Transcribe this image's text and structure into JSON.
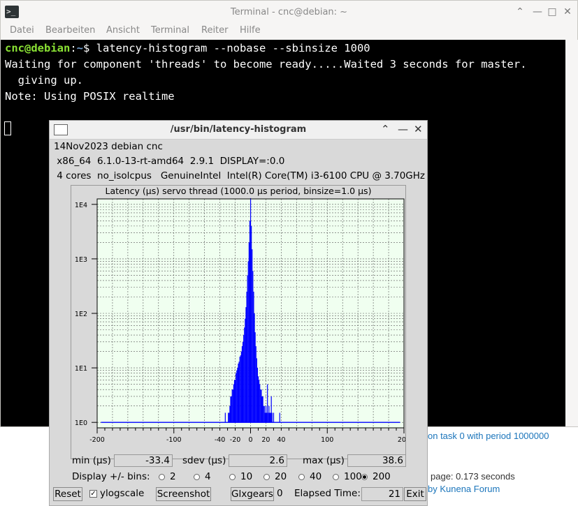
{
  "background": {
    "line1": "on task 0 with period 1000000",
    "line2": "page: 0.173 seconds",
    "line3": "by Kunena Forum"
  },
  "terminal": {
    "title": "Terminal - cnc@debian: ~",
    "menu": [
      "Datei",
      "Bearbeiten",
      "Ansicht",
      "Terminal",
      "Reiter",
      "Hilfe"
    ],
    "prompt_user": "cnc@debian",
    "prompt_sep": ":",
    "prompt_path": "~",
    "prompt_end": "$ latency-histogram --nobase --sbinsize 1000",
    "output": [
      "Waiting for component 'threads' to become ready.....Waited 3 seconds for master.",
      "  giving up.",
      "Note: Using POSIX realtime"
    ]
  },
  "histogram_window": {
    "title": "/usr/bin/latency-histogram",
    "info_line1": "14Nov2023 debian cnc",
    "info_line2": " x86_64  6.1.0-13-rt-amd64  2.9.1  DISPLAY=:0.0",
    "info_line3": " 4 cores  no_isolcpus   GenuineIntel  Intel(R) Core(TM) i3-6100 CPU @ 3.70GHz",
    "stats": {
      "min_label": "min (µs)",
      "min_value": "-33.4",
      "sdev_label": "sdev (µs)",
      "sdev_value": "2.6",
      "max_label": "max (µs)",
      "max_value": "38.6"
    },
    "bins_label": "Display +/- bins:",
    "bins_options": [
      "2",
      "4",
      "10",
      "20",
      "40",
      "100",
      "200"
    ],
    "bins_selected": "200",
    "buttons": {
      "reset": "Reset",
      "ylogscale": "ylogscale",
      "screenshot": "Screenshot",
      "glxgears": "Glxgears",
      "glxgears_count": "0",
      "elapsed_label": "Elapsed Time:",
      "elapsed_value": "21",
      "exit": "Exit"
    },
    "colors": {
      "bars": "#0000ff",
      "plot_bg": "#f0fff0",
      "grid": "#555555"
    }
  },
  "chart_data": {
    "type": "bar",
    "title": "Latency (µs) servo thread (1000.0 µs period, binsize=1.0 µs)",
    "xlabel": "",
    "ylabel": "",
    "xlim": [
      -200,
      200
    ],
    "ylim_log10": [
      -0.1,
      4.1
    ],
    "log_scale_y": true,
    "x_ticks": [
      -200,
      -100,
      -40,
      -20,
      0,
      20,
      40,
      100,
      200
    ],
    "x_tick_labels": [
      "-200",
      "-100",
      "-40",
      "-20",
      "0",
      "20",
      "40",
      "100",
      "200"
    ],
    "y_tick_labels": [
      "1E0",
      "1E1",
      "1E2",
      "1E3",
      "1E4"
    ],
    "grid": true,
    "series": [
      {
        "values": [
          [
            -33,
            1.5
          ],
          [
            -29,
            1.5
          ],
          [
            -28,
            1.5
          ],
          [
            -27,
            2
          ],
          [
            -26,
            3
          ],
          [
            -25,
            3
          ],
          [
            -24,
            4
          ],
          [
            -23,
            4
          ],
          [
            -22,
            5
          ],
          [
            -21,
            6
          ],
          [
            -20,
            6
          ],
          [
            -19,
            8
          ],
          [
            -18,
            9
          ],
          [
            -17,
            10
          ],
          [
            -16,
            12
          ],
          [
            -15,
            13
          ],
          [
            -14,
            16
          ],
          [
            -13,
            17
          ],
          [
            -12,
            20
          ],
          [
            -11,
            25
          ],
          [
            -10,
            30
          ],
          [
            -9,
            40
          ],
          [
            -8,
            55
          ],
          [
            -7,
            80
          ],
          [
            -6,
            130
          ],
          [
            -5,
            250
          ],
          [
            -4,
            500
          ],
          [
            -3,
            900
          ],
          [
            -2,
            2000
          ],
          [
            -1,
            5000
          ],
          [
            0,
            13000
          ],
          [
            1,
            4000
          ],
          [
            2,
            1500
          ],
          [
            3,
            600
          ],
          [
            4,
            250
          ],
          [
            5,
            100
          ],
          [
            6,
            45
          ],
          [
            7,
            25
          ],
          [
            8,
            15
          ],
          [
            9,
            10
          ],
          [
            10,
            7
          ],
          [
            11,
            6
          ],
          [
            12,
            5
          ],
          [
            13,
            4
          ],
          [
            14,
            4
          ],
          [
            15,
            3
          ],
          [
            16,
            3
          ],
          [
            17,
            2
          ],
          [
            18,
            2
          ],
          [
            19,
            1.5
          ],
          [
            20,
            2
          ],
          [
            21,
            1.5
          ],
          [
            22,
            5
          ],
          [
            23,
            1.5
          ],
          [
            24,
            2
          ],
          [
            25,
            1.5
          ],
          [
            26,
            1.5
          ],
          [
            27,
            3
          ],
          [
            28,
            1.5
          ],
          [
            30,
            1.5
          ],
          [
            38,
            1.5
          ]
        ]
      }
    ]
  }
}
